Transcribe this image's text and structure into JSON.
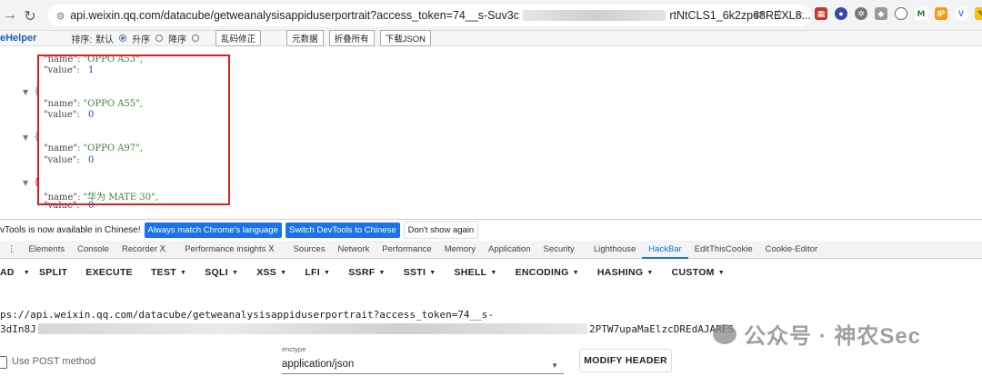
{
  "browser": {
    "url_start": "api.weixin.qq.com/datacube/getweanalysisappiduserportrait?access_token=74__s-Suv3c",
    "url_end": "rtNtCLS1_6k2zp68REXL8..."
  },
  "jsonhelper": {
    "brand": "eHelper",
    "sort_label": "排序:",
    "opt_default": "默认",
    "opt_asc": "升序",
    "opt_desc": "降序",
    "btn_fix": "乱码修正",
    "btn_raw": "元数据",
    "btn_fold": "折叠所有",
    "btn_download": "下载JSON"
  },
  "json": {
    "l1_key": "\"name\":",
    "l1_val": "\"OPPO A53\",",
    "l2_key": "\"value\":",
    "l2_val": "1",
    "l3_key": "\"name\":",
    "l3_val": "\"OPPO A55\",",
    "l4_key": "\"value\":",
    "l4_val": "0",
    "l5_key": "\"name\":",
    "l5_val": "\"OPPO A97\",",
    "l6_key": "\"value\":",
    "l6_val": "0",
    "l7_key": "\"name\":",
    "l7_val": "\"华为 MATE 30\",",
    "l8_key": "\"value\":",
    "l8_val": "0"
  },
  "devtools_banner": {
    "text": "vTools is now available in Chinese!",
    "btn_match": "Always match Chrome's language",
    "btn_switch": "Switch DevTools to Chinese",
    "btn_dismiss": "Don't show again"
  },
  "devtools_tabs": [
    "Elements",
    "Console",
    "Recorder Ⅹ",
    "Performance insights Ⅹ",
    "Sources",
    "Network",
    "Performance",
    "Memory",
    "Application",
    "Security",
    "Lighthouse",
    "HackBar",
    "EditThisCookie",
    "Cookie-Editor"
  ],
  "hackbar_menu": [
    "AD",
    "SPLIT",
    "EXECUTE",
    "TEST",
    "SQLI",
    "XSS",
    "LFI",
    "SSRF",
    "SSTI",
    "SHELL",
    "ENCODING",
    "HASHING",
    "CUSTOM"
  ],
  "hackbar": {
    "url_line1": "ps://api.weixin.qq.com/datacube/getweanalysisappiduserportrait?access_token=74__s-",
    "url_line2_start": "3dIn8J",
    "url_line2_end": "2PTW7upaMaElzcDREdAJARES",
    "post_label": "Use POST method",
    "enctype_label": "enctype",
    "enctype_value": "application/json",
    "modify_header": "MODIFY HEADER"
  },
  "watermark": "公众号 · 神农Sec"
}
